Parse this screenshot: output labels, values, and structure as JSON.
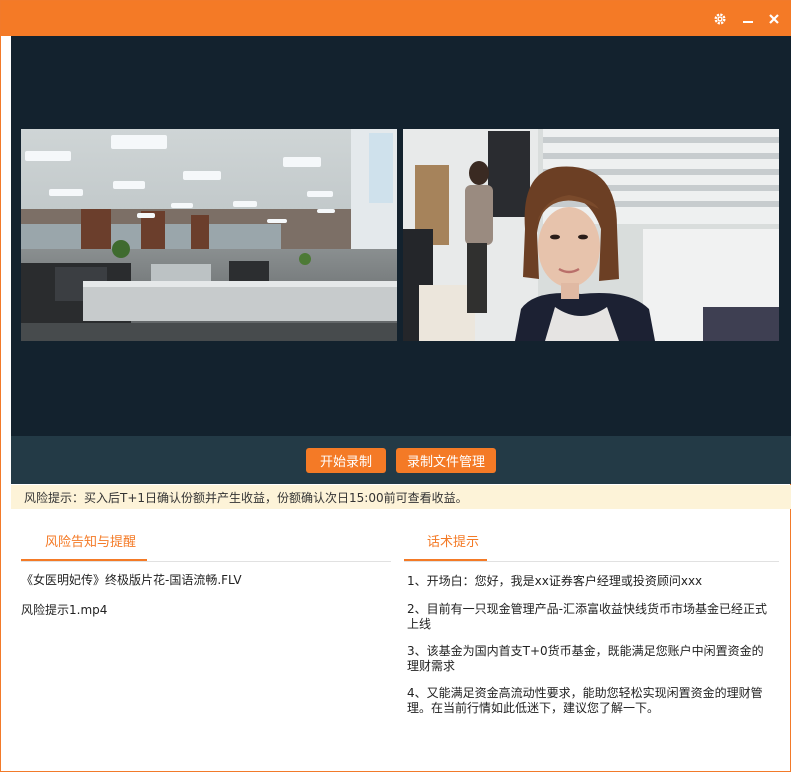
{
  "titlebar": {
    "icons": [
      "gear-icon",
      "minimize-icon",
      "close-icon"
    ],
    "accent_color": "#f47a26"
  },
  "video": {
    "background_color": "#13222e",
    "feeds": [
      "office-camera-feed",
      "customer-camera-feed"
    ]
  },
  "controls": {
    "record_label": "开始录制",
    "files_label": "录制文件管理"
  },
  "risk_banner": {
    "text": "风险提示：买入后T+1日确认份额并产生收益，份额确认次日15:00前可查看收益。"
  },
  "left_panel": {
    "tab_label": "风险告知与提醒",
    "files": [
      "《女医明妃传》终极版片花-国语流畅.FLV",
      "风险提示1.mp4"
    ]
  },
  "right_panel": {
    "tab_label": "话术提示",
    "tips": [
      "1、开场白：您好，我是xx证券客户经理或投资顾问xxx",
      "2、目前有一只现金管理产品-汇添富收益快线货币市场基金已经正式上线",
      "3、该基金为国内首支T+0货币基金，既能满足您账户中闲置资金的理财需求",
      "4、又能满足资金高流动性要求，能助您轻松实现闲置资金的理财管理。在当前行情如此低迷下，建议您了解一下。"
    ]
  }
}
